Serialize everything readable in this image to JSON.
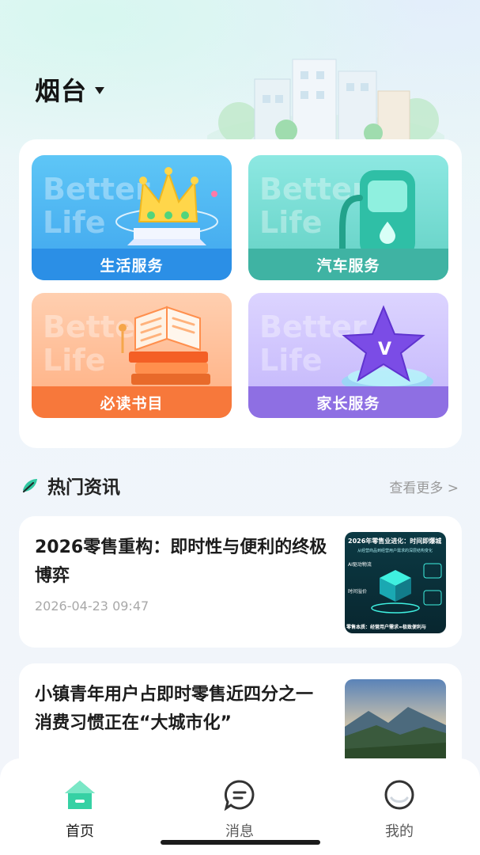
{
  "header": {
    "city": "烟台"
  },
  "services": [
    {
      "label": "生活服务",
      "watermark_1": "Better",
      "watermark_2": "Life",
      "icon": "crown-icon"
    },
    {
      "label": "汽车服务",
      "watermark_1": "Better",
      "watermark_2": "Life",
      "icon": "fuel-pump-icon"
    },
    {
      "label": "必读书目",
      "watermark_1": "Better",
      "watermark_2": "Life",
      "icon": "book-icon"
    },
    {
      "label": "家长服务",
      "watermark_1": "Better",
      "watermark_2": "Life",
      "icon": "star-badge-icon"
    }
  ],
  "news": {
    "title": "热门资讯",
    "more": "查看更多 >",
    "items": [
      {
        "headline": "2026零售重构：即时性与便利的终极博弈",
        "date": "2026-04-23 09:47",
        "thumb_title": "2026年零售业进化：时间即爆城",
        "thumb_sub": "从经营商品到经营用户需求的深层结构变化",
        "thumb_tag_1": "AI驱动物流",
        "thumb_tag_2": "时间溢价",
        "thumb_footer": "零售本质：经营用户需求=极致便利与"
      },
      {
        "headline": "小镇青年用户占即时零售近四分之一消费习惯正在“大城市化”",
        "date": ""
      }
    ]
  },
  "tabbar": {
    "tabs": [
      {
        "label": "首页",
        "icon": "home-icon"
      },
      {
        "label": "消息",
        "icon": "message-icon"
      },
      {
        "label": "我的",
        "icon": "profile-icon"
      }
    ]
  },
  "colors": {
    "life_service": "#2b8fe6",
    "car_service": "#3fb3a3",
    "books": "#f7783b",
    "parent_service": "#8e6fe3",
    "accent_green": "#2fc7a0"
  }
}
